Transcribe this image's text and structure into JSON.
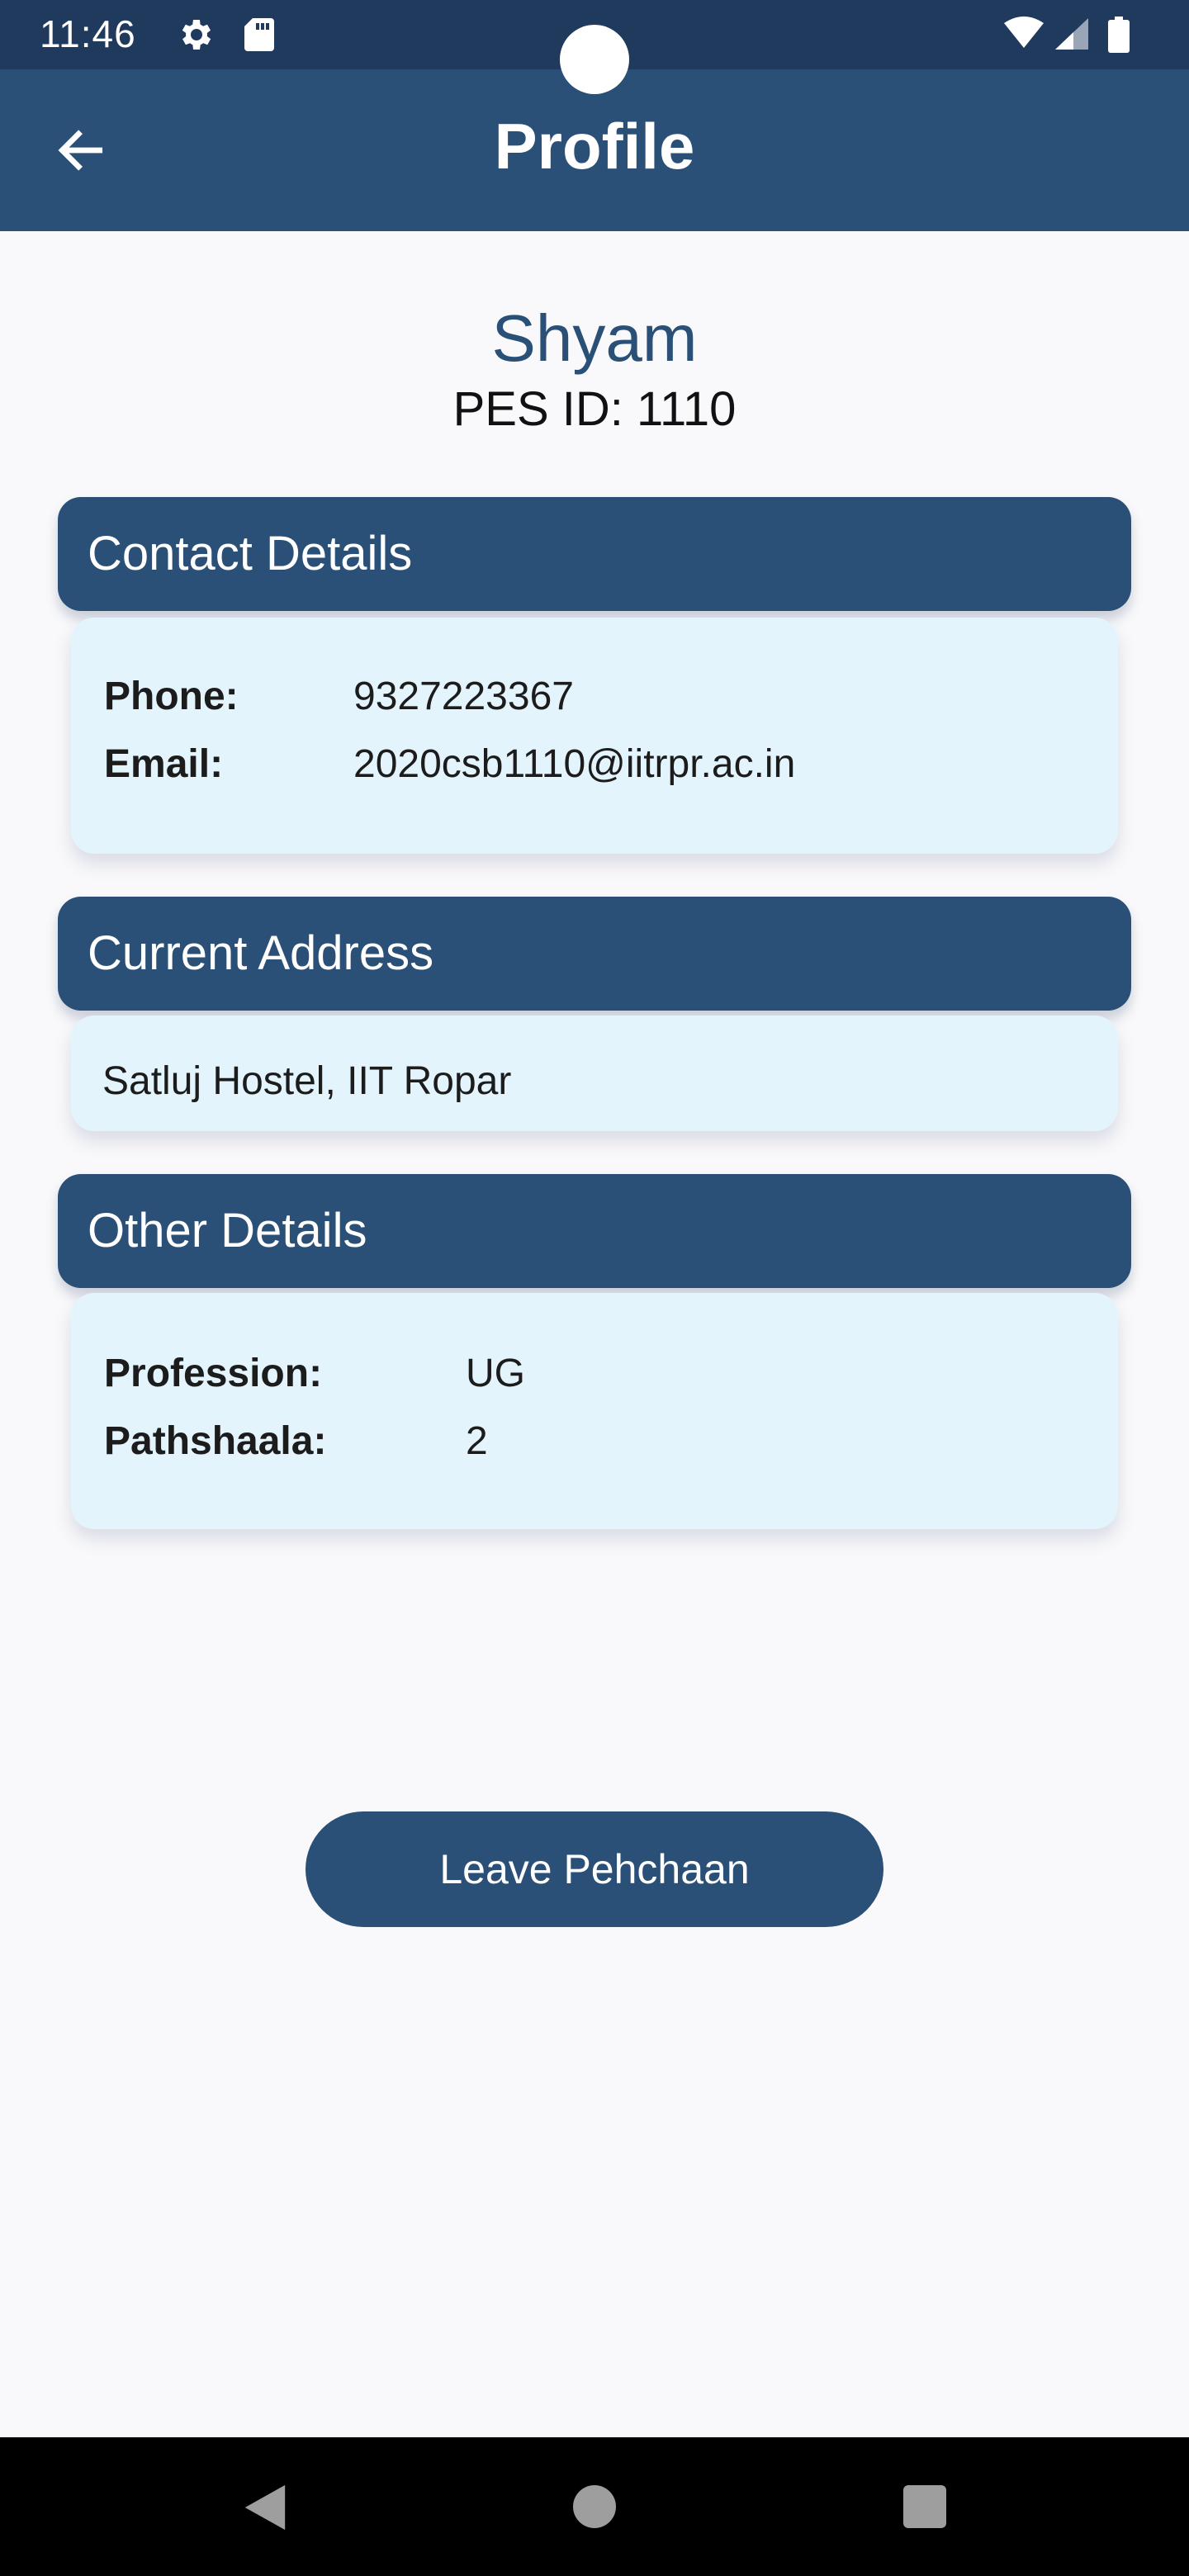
{
  "status_bar": {
    "time": "11:46",
    "icons": [
      "gear-icon",
      "sd-card-icon",
      "wifi-icon",
      "signal-icon",
      "battery-icon"
    ]
  },
  "app_bar": {
    "title": "Profile",
    "back_icon": "arrow-back-icon"
  },
  "profile": {
    "name": "Shyam",
    "pes_id_label": "PES ID:",
    "pes_id_value": "1110"
  },
  "contact": {
    "header": "Contact Details",
    "phone_label": "Phone:",
    "phone_value": "9327223367",
    "email_label": "Email:",
    "email_value": "2020csb1110@iitrpr.ac.in"
  },
  "address": {
    "header": "Current Address",
    "value": "Satluj Hostel, IIT Ropar"
  },
  "other": {
    "header": "Other Details",
    "profession_label": "Profession:",
    "profession_value": "UG",
    "pathshaala_label": "Pathshaala:",
    "pathshaala_value": "2"
  },
  "actions": {
    "leave_label": "Leave Pehchaan"
  },
  "colors": {
    "primary": "#2a5077",
    "status_bar": "#1f3a5c",
    "card_background": "#e3f4fd",
    "page_background": "#f9f9fb"
  },
  "nav_bar": {
    "icons": [
      "nav-back-icon",
      "nav-home-icon",
      "nav-recents-icon"
    ]
  }
}
